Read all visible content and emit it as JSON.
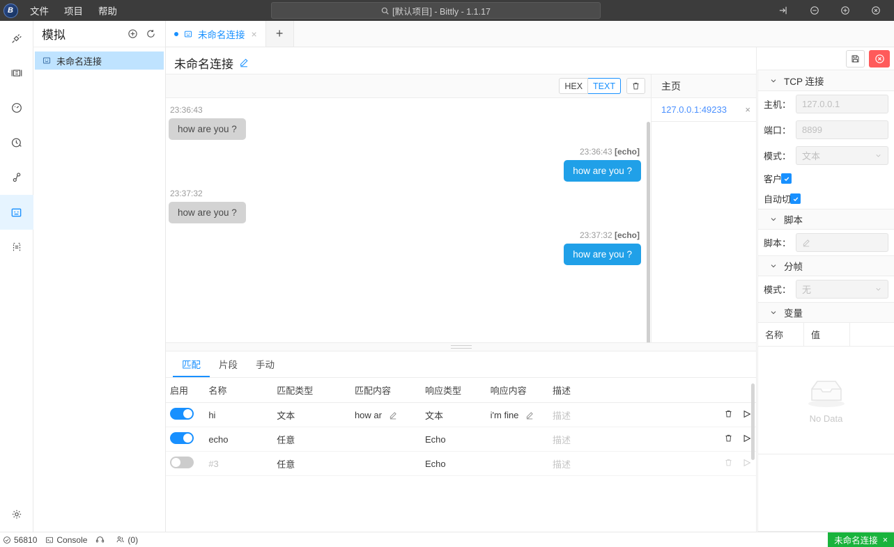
{
  "titlebar": {
    "app_title": "[默认项目] - Bittly - 1.1.17",
    "logo_text": "B",
    "menus": [
      {
        "label": "文件",
        "name": "menu-file"
      },
      {
        "label": "项目",
        "name": "menu-project"
      },
      {
        "label": "帮助",
        "name": "menu-help"
      }
    ],
    "window_controls": [
      {
        "icon": "pin-icon",
        "glyph": "⇥"
      },
      {
        "icon": "minimize-icon",
        "glyph": "⊖"
      },
      {
        "icon": "maximize-icon",
        "glyph": "⊕"
      },
      {
        "icon": "close-icon",
        "glyph": "⊗"
      }
    ]
  },
  "rail": {
    "items": [
      {
        "name": "sidebar-item-connection",
        "icon": "plug-icon",
        "active": false
      },
      {
        "name": "sidebar-item-panel",
        "icon": "panel-icon",
        "active": false
      },
      {
        "name": "sidebar-item-dashboard",
        "icon": "gauge-icon",
        "active": false
      },
      {
        "name": "sidebar-item-timer",
        "icon": "clock-icon",
        "active": false
      },
      {
        "name": "sidebar-item-flow",
        "icon": "nodes-icon",
        "active": false
      },
      {
        "name": "sidebar-item-simulator",
        "icon": "simulator-icon",
        "active": true
      },
      {
        "name": "sidebar-item-template",
        "icon": "brackets-icon",
        "active": false
      }
    ],
    "settings_icon": "gear-icon"
  },
  "panel": {
    "title": "模拟",
    "add_icon": "plus-circle-icon",
    "refresh_icon": "refresh-icon",
    "items": [
      {
        "label": "未命名连接",
        "icon": "simulator-icon",
        "active": true
      }
    ]
  },
  "tabs": {
    "open": [
      {
        "label": "未命名连接",
        "icon": "simulator-icon",
        "close": "×"
      }
    ],
    "add_label": "+"
  },
  "header": {
    "title": "未命名连接",
    "edit_icon": "pencil-icon"
  },
  "conversation": {
    "toolbar": {
      "hex_label": "HEX",
      "text_label": "TEXT",
      "active_format": "TEXT",
      "clear_icon": "trash-icon"
    },
    "messages": [
      {
        "dir": "in",
        "time": "23:36:43",
        "tag": "",
        "text": "how are you ?"
      },
      {
        "dir": "out",
        "time": "23:36:43",
        "tag": "[echo]",
        "text": "how are you ?"
      },
      {
        "dir": "in",
        "time": "23:37:32",
        "tag": "",
        "text": "how are you ?"
      },
      {
        "dir": "out",
        "time": "23:37:32",
        "tag": "[echo]",
        "text": "how are you ?"
      }
    ]
  },
  "sessions": {
    "title": "主页",
    "items": [
      {
        "label": "127.0.0.1:49233",
        "close": "×"
      }
    ]
  },
  "rules": {
    "tabs": [
      {
        "label": "匹配",
        "active": true
      },
      {
        "label": "片段",
        "active": false
      },
      {
        "label": "手动",
        "active": false
      }
    ],
    "columns": [
      "启用",
      "名称",
      "匹配类型",
      "匹配内容",
      "响应类型",
      "响应内容",
      "描述",
      ""
    ],
    "rows": [
      {
        "enabled": true,
        "name": "hi",
        "match_type": "文本",
        "match_content": "how ar",
        "match_content_editable": true,
        "response_type": "文本",
        "response_content": "i'm fine",
        "response_content_editable": true,
        "description_placeholder": "描述",
        "delete_icon": "trash-icon",
        "run_icon": "play-icon"
      },
      {
        "enabled": true,
        "name": "echo",
        "match_type": "任意",
        "match_content": "",
        "match_content_editable": false,
        "response_type": "Echo",
        "response_content": "",
        "response_content_editable": false,
        "description_placeholder": "描述",
        "delete_icon": "trash-icon",
        "run_icon": "play-icon"
      },
      {
        "enabled": false,
        "name": "#3",
        "match_type": "任意",
        "match_content": "",
        "match_content_editable": false,
        "response_type": "Echo",
        "response_content": "",
        "response_content_editable": false,
        "description_placeholder": "描述",
        "delete_icon": "trash-icon",
        "run_icon": "play-icon"
      }
    ]
  },
  "config": {
    "save_icon": "save-icon",
    "stop_icon": "stop-circle-icon",
    "sections": {
      "tcp": {
        "title": "TCP 连接",
        "host_label": "主机：",
        "host_value": "127.0.0.1",
        "port_label": "端口：",
        "port_value": "8899",
        "mode_label": "模式：",
        "mode_value": "文本",
        "client_label": "客户端",
        "client_checked": true,
        "autoswitch_label": "自动切换",
        "autoswitch_checked": true
      },
      "script": {
        "title": "脚本",
        "script_label": "脚本：",
        "script_value": "",
        "script_icon": "pencil-icon"
      },
      "frame": {
        "title": "分帧",
        "mode_label": "模式：",
        "mode_value": "无"
      },
      "variables": {
        "title": "变量",
        "col_name": "名称",
        "col_value": "值",
        "empty_text": "No Data",
        "empty_icon": "inbox-icon"
      }
    }
  },
  "statusbar": {
    "left": [
      {
        "name": "status-pid",
        "icon": "check-circle-icon",
        "label": "56810"
      },
      {
        "name": "status-console",
        "icon": "terminal-icon",
        "label": "Console"
      },
      {
        "name": "status-support",
        "icon": "headset-icon",
        "label": ""
      },
      {
        "name": "status-online-users",
        "icon": "people-icon",
        "label": "(0)"
      }
    ],
    "badge": {
      "label": "未命名连接",
      "close": "×",
      "color": "#19b33c"
    }
  },
  "colors": {
    "accent": "#1890ff",
    "titlebar": "#3c3c3c",
    "bubble_out": "#20a0e8",
    "bubble_in": "#d3d3d3",
    "danger": "#ff5a5a",
    "success": "#19b33c"
  }
}
